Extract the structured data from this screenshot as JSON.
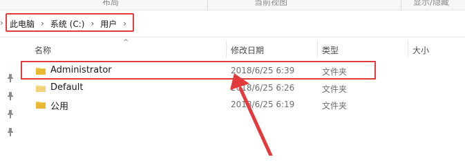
{
  "ribbon": {
    "groups": [
      "布局",
      "当前视图",
      "显示/隐藏"
    ]
  },
  "breadcrumb": {
    "items": [
      "此电脑",
      "系统 (C:)",
      "用户"
    ]
  },
  "columns": {
    "name": "名称",
    "date": "修改日期",
    "type": "类型",
    "size": "大小"
  },
  "rows": [
    {
      "name": "Administrator",
      "date": "2018/6/25 6:39",
      "type": "文件夹"
    },
    {
      "name": "Default",
      "date": "2018/6/25 6:26",
      "type": "文件夹"
    },
    {
      "name": "公用",
      "date": "2018/6/25 6:19",
      "type": "文件夹"
    }
  ],
  "colors": {
    "annotation_red": "#e33b3b",
    "folder_yellow": "#f2c94c"
  }
}
